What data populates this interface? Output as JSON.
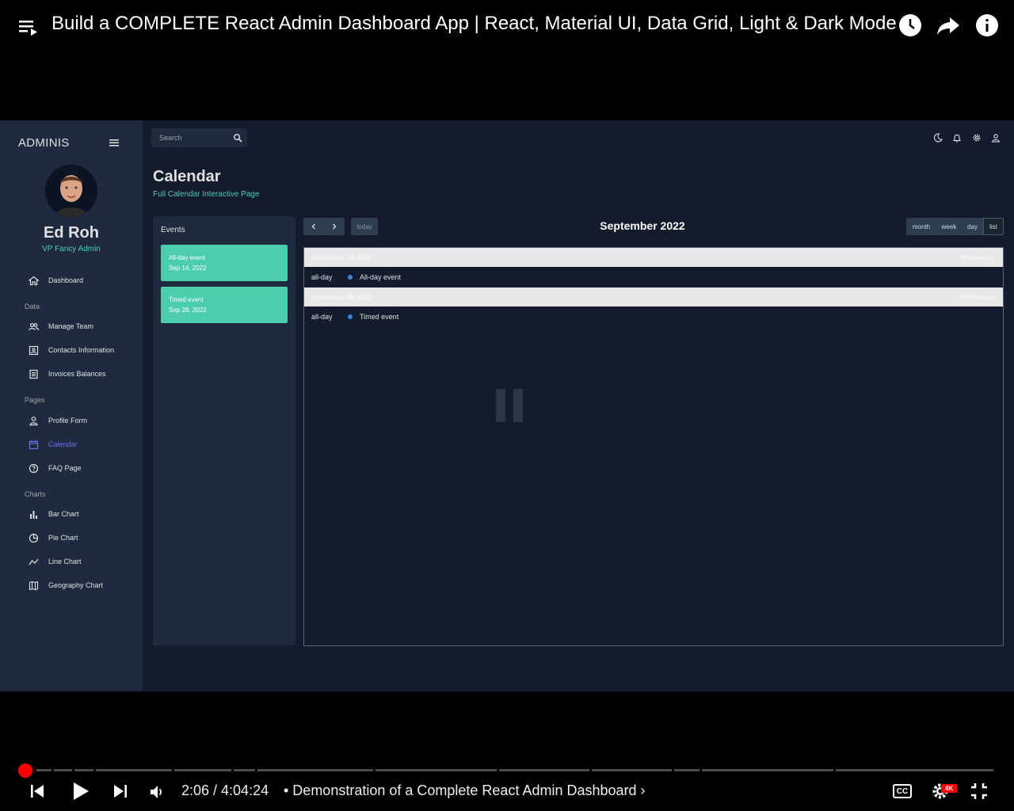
{
  "player": {
    "video_title": "Build a COMPLETE React Admin Dashboard App | React, Material UI, Data Grid, Light & Dark Mode",
    "time_display": "2:06 / 4:04:24",
    "chapter": "• Demonstration of a Complete React Admin Dashboard ›",
    "quality_badge": "4K",
    "cc_label": "CC",
    "progress_fraction": 0.0086
  },
  "app": {
    "brand": "ADMINIS",
    "user": {
      "name": "Ed Roh",
      "role": "VP Fancy Admin"
    },
    "nav": {
      "dashboard": "Dashboard",
      "section_data": "Data",
      "manage_team": "Manage Team",
      "contacts": "Contacts Information",
      "invoices": "Invoices Balances",
      "section_pages": "Pages",
      "profile_form": "Profile Form",
      "calendar": "Calendar",
      "faq": "FAQ Page",
      "section_charts": "Charts",
      "bar_chart": "Bar Chart",
      "pie_chart": "Pie Chart",
      "line_chart": "Line Chart",
      "geography_chart": "Geography Chart"
    },
    "search": {
      "placeholder": "Search"
    },
    "header": {
      "title": "Calendar",
      "subtitle": "Full Calendar Interactive Page"
    },
    "events_panel": {
      "title": "Events",
      "events": [
        {
          "title": "All-day event",
          "date": "Sep 14, 2022"
        },
        {
          "title": "Timed event",
          "date": "Sep 28, 2022"
        }
      ]
    },
    "calendar": {
      "title": "September 2022",
      "today_label": "today",
      "views": {
        "month": "month",
        "week": "week",
        "day": "day",
        "list": "list"
      },
      "active_view": "list",
      "list": [
        {
          "date": "September 14, 2022",
          "weekday": "Wednesday",
          "time": "all-day",
          "event": "All-day event"
        },
        {
          "date": "September 28, 2022",
          "weekday": "Wednesday",
          "time": "all-day",
          "event": "Timed event"
        }
      ]
    }
  },
  "colors": {
    "app_bg": "#141b2d",
    "panel_bg": "#1f2a40",
    "accent_green": "#4cceac",
    "active_nav": "#6870fa",
    "event_dot": "#3788d8",
    "progress_red": "#ff0000"
  },
  "icons": [
    "playlist-icon",
    "watch-later-icon",
    "share-icon",
    "info-icon",
    "search-icon",
    "dark-mode-icon",
    "notifications-icon",
    "settings-icon",
    "person-icon",
    "home-icon",
    "people-icon",
    "contacts-icon",
    "receipt-icon",
    "person-outline-icon",
    "calendar-icon",
    "help-icon",
    "bar-chart-icon",
    "pie-chart-icon",
    "timeline-icon",
    "map-icon",
    "prev-icon",
    "play-icon",
    "next-icon",
    "volume-icon",
    "cc-icon",
    "settings-gear-icon",
    "exit-fullscreen-icon"
  ]
}
